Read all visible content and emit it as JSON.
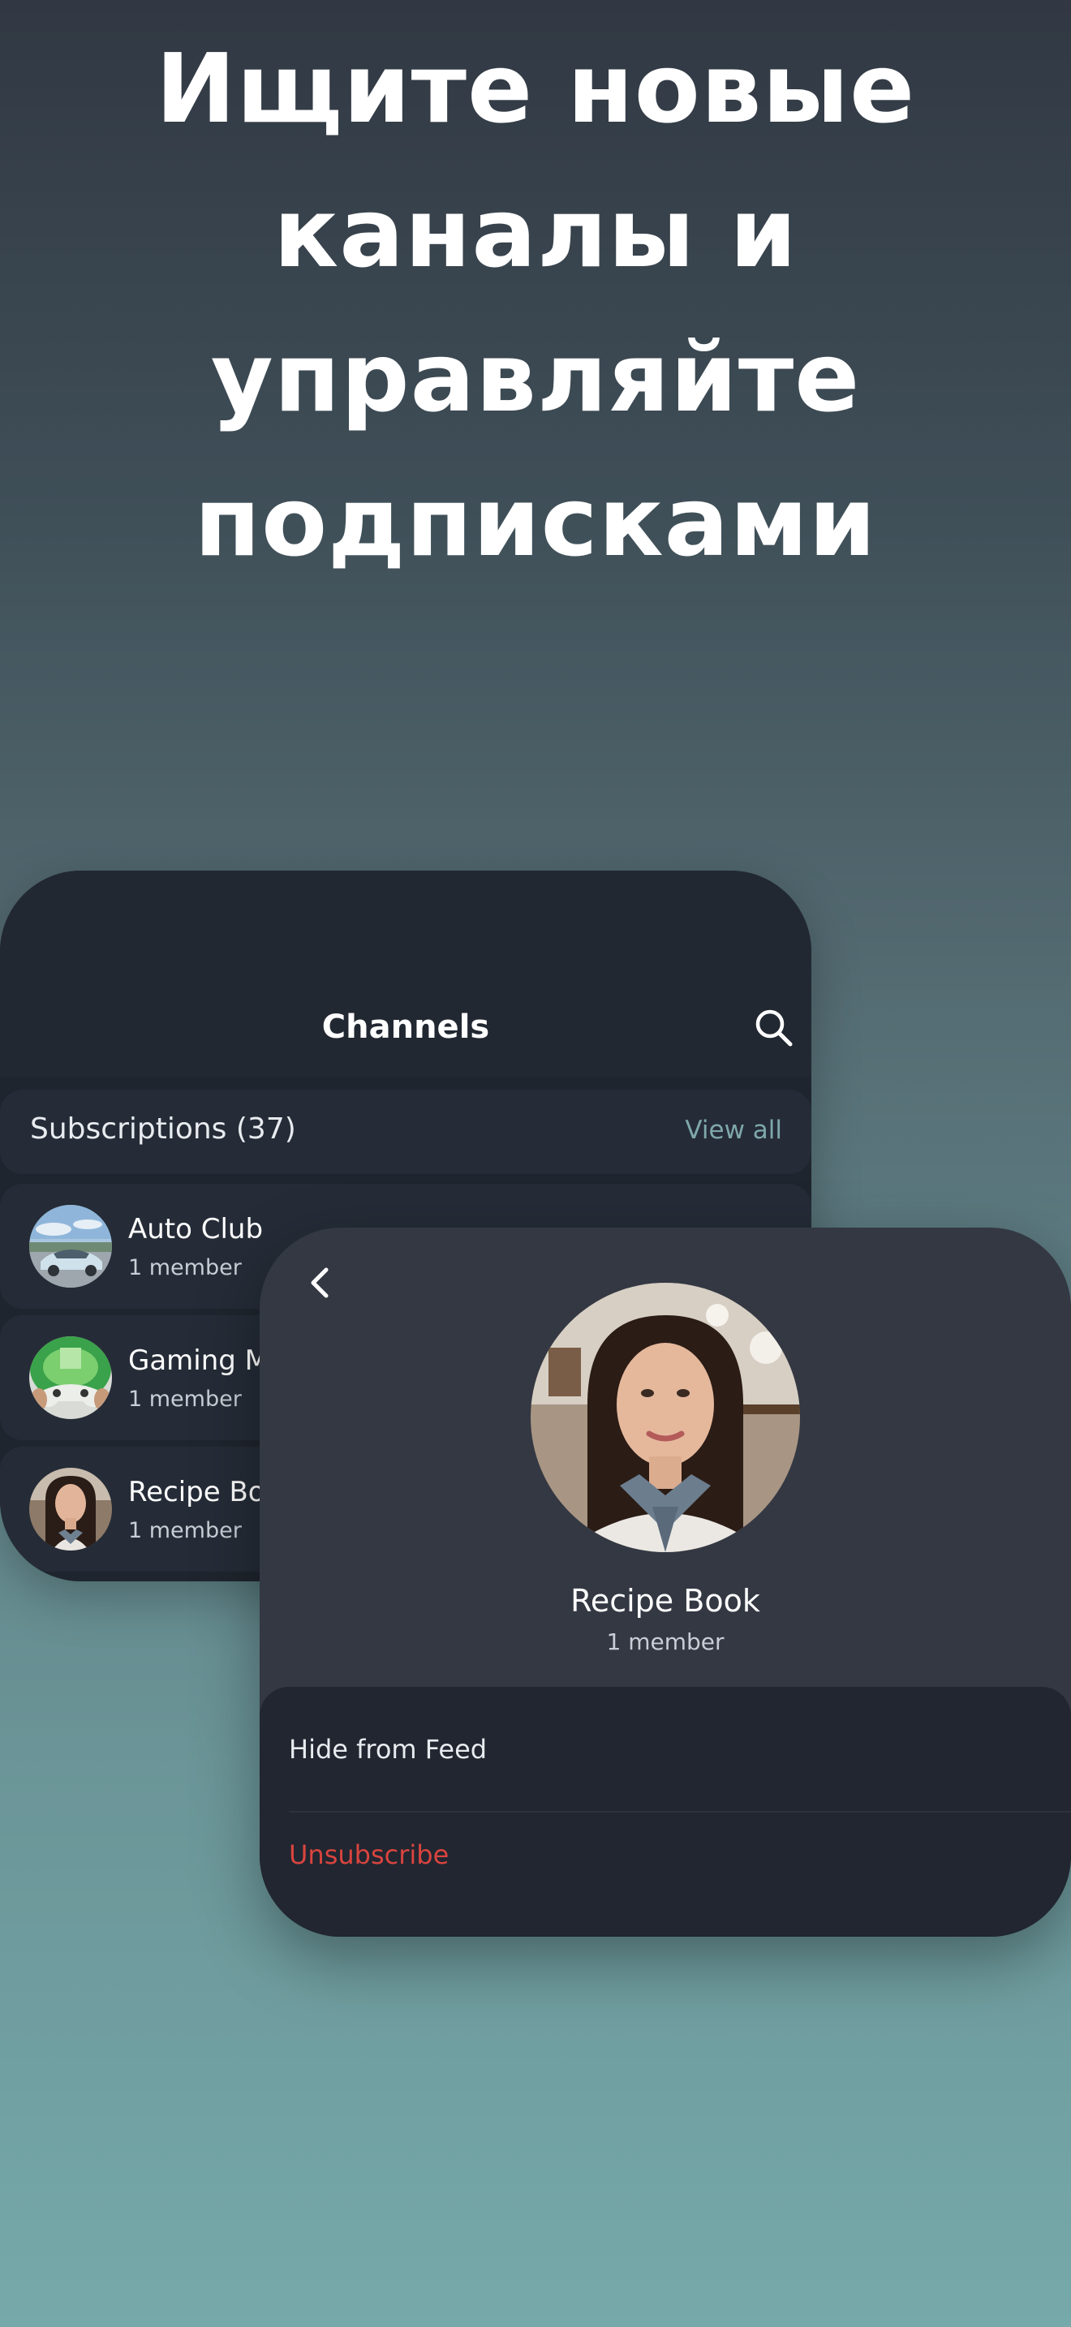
{
  "headline": {
    "line1": "Ищите новые",
    "line2": "каналы и",
    "line3": "управляйте",
    "line4": "подписками"
  },
  "channels_screen": {
    "title": "Channels",
    "search_icon": "search-icon",
    "subscriptions": {
      "label": "Subscriptions (37)",
      "view_all": "View all"
    },
    "channels": [
      {
        "name": "Auto Club",
        "members": "1 member",
        "avatar": "car-photo"
      },
      {
        "name": "Gaming M",
        "members": "1 member",
        "avatar": "gamepad-photo"
      },
      {
        "name": "Recipe Boo",
        "members": "1 member",
        "avatar": "woman-portrait"
      }
    ]
  },
  "detail_screen": {
    "back_icon": "chevron-left-icon",
    "channel_name": "Recipe Book",
    "members": "1 member",
    "actions": {
      "hide": "Hide from Feed",
      "unsubscribe": "Unsubscribe"
    }
  },
  "colors": {
    "accent_teal": "#7fa8aa",
    "danger_red": "#d9443f",
    "card_dark": "#1f252e",
    "card_detail": "#333843"
  }
}
